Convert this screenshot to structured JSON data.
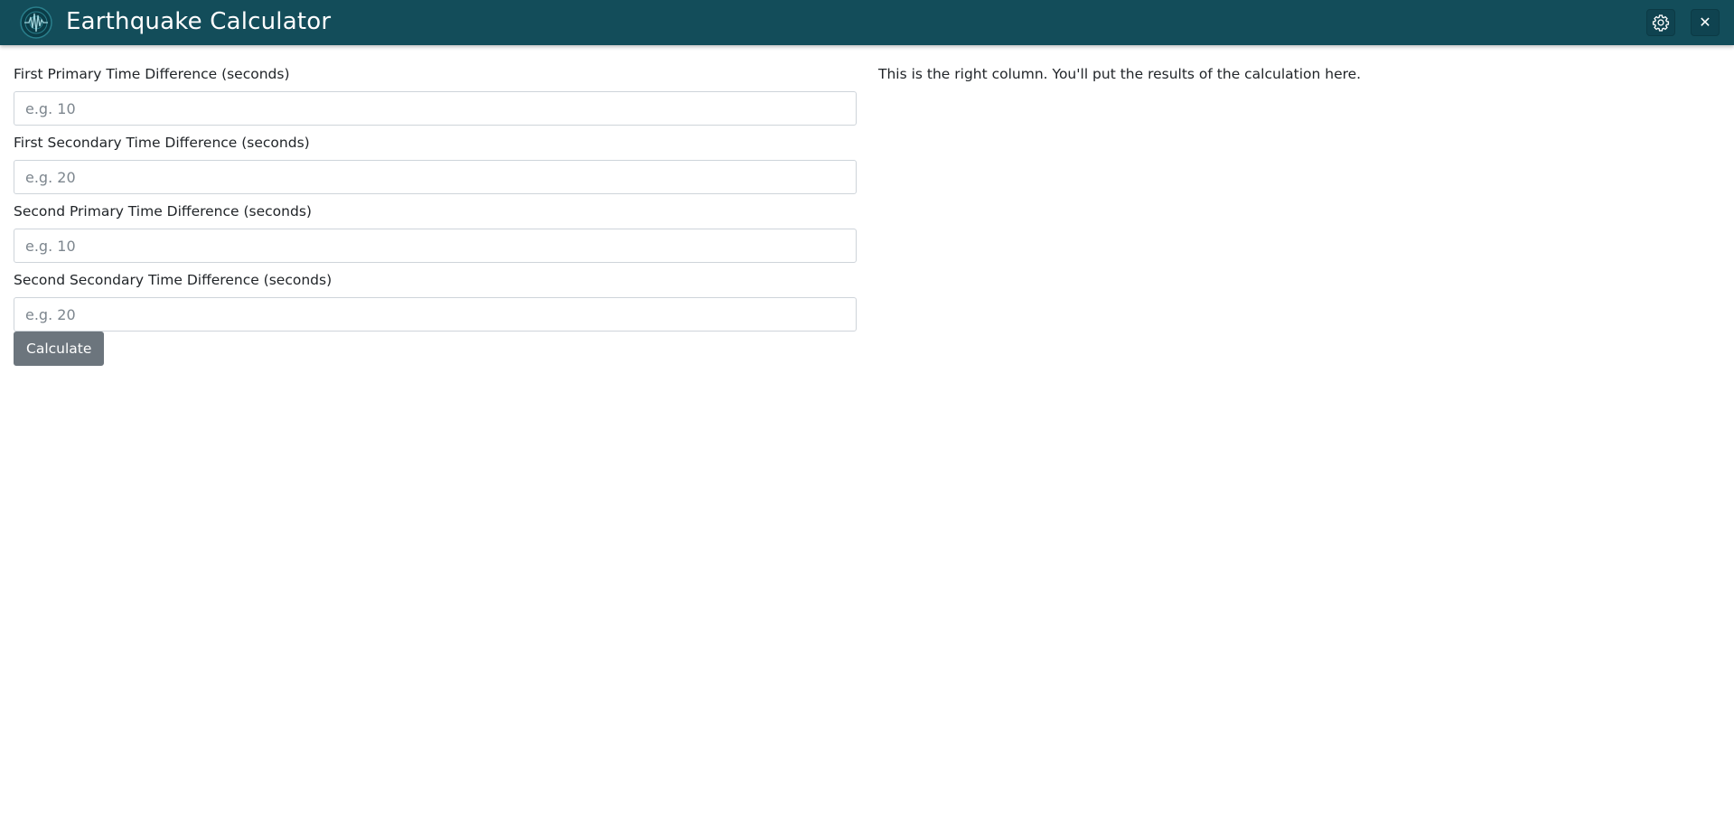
{
  "window": {
    "title": "Earthquake Calculator",
    "logo_icon": "seismograph-logo-icon",
    "settings_icon": "gear-icon",
    "close_icon": "close-icon",
    "close_glyph": "✕",
    "colors": {
      "titlebar": "#134d5a",
      "button": "#6c757d"
    }
  },
  "form": {
    "fields": [
      {
        "label": "First Primary Time Difference (seconds)",
        "placeholder": "e.g. 10",
        "value": ""
      },
      {
        "label": "First Secondary Time Difference (seconds)",
        "placeholder": "e.g. 20",
        "value": ""
      },
      {
        "label": "Second Primary Time Difference (seconds)",
        "placeholder": "e.g. 10",
        "value": ""
      },
      {
        "label": "Second Secondary Time Difference (seconds)",
        "placeholder": "e.g. 20",
        "value": ""
      }
    ],
    "calculate_label": "Calculate"
  },
  "results": {
    "text": "This is the right column. You'll put the results of the calculation here."
  }
}
